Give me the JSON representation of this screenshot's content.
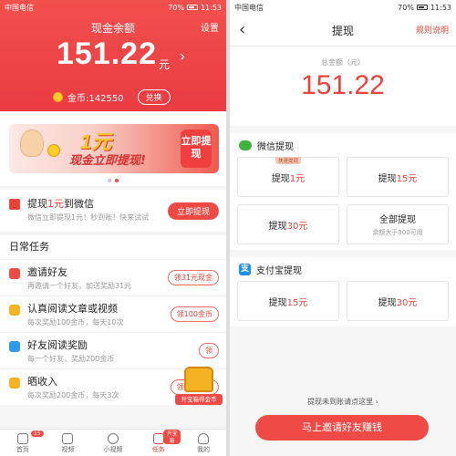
{
  "left": {
    "status": {
      "carrier": "中国电信",
      "signal": "70%",
      "time": "11:53"
    },
    "header": {
      "title": "现金余额",
      "settings": "设置",
      "amount": "151.22",
      "unit": "元",
      "coins_label": "金币:142550",
      "exchange_button": "兑换"
    },
    "banner": {
      "big": "1元",
      "sub": "现金立即提现!",
      "cta": "立即提现"
    },
    "withdraw": {
      "title_prefix": "提现",
      "title_amount": "1元",
      "title_suffix": "到微信",
      "subtitle": "微信立即提现1元！秒到账！快来试试",
      "button": "立即提现"
    },
    "daily": {
      "title": "日常任务",
      "tasks": [
        {
          "title": "邀请好友",
          "subtitle": "再邀请一个好友，加送奖励31元",
          "button": "领31元现金",
          "color": "#ef4a45"
        },
        {
          "title": "认真阅读文章或视频",
          "subtitle": "每次奖励100金币，每天10次",
          "button": "领100金币",
          "color": "#f5b323"
        },
        {
          "title": "好友阅读奖励",
          "subtitle": "每一个好友，奖励200金币",
          "button": "领",
          "color": "#2e9ae8"
        },
        {
          "title": "晒收入",
          "subtitle": "每次奖励200金币，每天3次",
          "button": "领200金币",
          "color": "#f5b323"
        }
      ],
      "treasure_label": "开宝箱得金币"
    },
    "tabs": [
      {
        "label": "首页",
        "badge": "15"
      },
      {
        "label": "视频"
      },
      {
        "label": "小视频"
      },
      {
        "label": "任务",
        "badge": "开宝箱"
      },
      {
        "label": "我的"
      }
    ]
  },
  "right": {
    "status": {
      "carrier": "中国电信",
      "signal": "70%",
      "time": "11:53"
    },
    "nav": {
      "back": "‹",
      "title": "提现",
      "rules": "规则说明"
    },
    "total_label": "总金额（元）",
    "total": "151.22",
    "wechat": {
      "title": "微信提现",
      "options": [
        {
          "prefix": "提现",
          "amount": "1元",
          "tag": "快速提现"
        },
        {
          "prefix": "提现",
          "amount": "15元"
        },
        {
          "prefix": "提现",
          "amount": "30元"
        },
        {
          "prefix": "全部提现",
          "amount": "",
          "sub": "余额大于300可用"
        }
      ]
    },
    "alipay": {
      "title": "支付宝提现",
      "options": [
        {
          "prefix": "提现",
          "amount": "15元"
        },
        {
          "prefix": "提现",
          "amount": "30元"
        }
      ]
    },
    "footer_link": "提现未到账请点这里 ›",
    "invite_button": "马上邀请好友赚钱"
  }
}
